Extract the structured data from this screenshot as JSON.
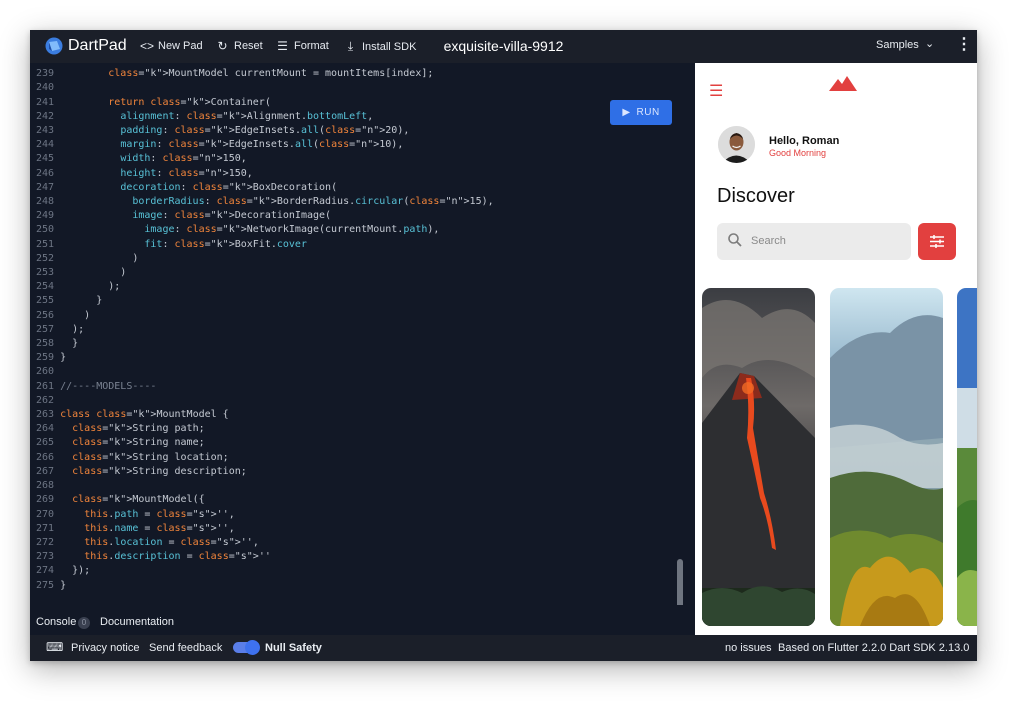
{
  "app": {
    "brand": "DartPad",
    "pad_title": "exquisite-villa-9912"
  },
  "toolbar": {
    "new_pad": "New Pad",
    "reset": "Reset",
    "format": "Format",
    "install_sdk": "Install SDK",
    "samples": "Samples"
  },
  "editor": {
    "run_label": "RUN",
    "lines": [
      {
        "n": "239",
        "code": "        MountModel currentMount = mountItems[index];"
      },
      {
        "n": "240",
        "code": ""
      },
      {
        "n": "241",
        "code": "        return Container("
      },
      {
        "n": "242",
        "code": "          alignment: Alignment.bottomLeft,"
      },
      {
        "n": "243",
        "code": "          padding: EdgeInsets.all(20),"
      },
      {
        "n": "244",
        "code": "          margin: EdgeInsets.all(10),"
      },
      {
        "n": "245",
        "code": "          width: 150,"
      },
      {
        "n": "246",
        "code": "          height: 150,"
      },
      {
        "n": "247",
        "code": "          decoration: BoxDecoration("
      },
      {
        "n": "248",
        "code": "            borderRadius: BorderRadius.circular(15),"
      },
      {
        "n": "249",
        "code": "            image: DecorationImage("
      },
      {
        "n": "250",
        "code": "              image: NetworkImage(currentMount.path),"
      },
      {
        "n": "251",
        "code": "              fit: BoxFit.cover"
      },
      {
        "n": "252",
        "code": "            )"
      },
      {
        "n": "253",
        "code": "          )"
      },
      {
        "n": "254",
        "code": "        );"
      },
      {
        "n": "255",
        "code": "      }"
      },
      {
        "n": "256",
        "code": "    )"
      },
      {
        "n": "257",
        "code": "  );"
      },
      {
        "n": "258",
        "code": "  }"
      },
      {
        "n": "259",
        "code": "}"
      },
      {
        "n": "260",
        "code": ""
      },
      {
        "n": "261",
        "code": "//----MODELS----"
      },
      {
        "n": "262",
        "code": ""
      },
      {
        "n": "263",
        "code": "class MountModel {"
      },
      {
        "n": "264",
        "code": "  String path;"
      },
      {
        "n": "265",
        "code": "  String name;"
      },
      {
        "n": "266",
        "code": "  String location;"
      },
      {
        "n": "267",
        "code": "  String description;"
      },
      {
        "n": "268",
        "code": ""
      },
      {
        "n": "269",
        "code": "  MountModel({"
      },
      {
        "n": "270",
        "code": "    this.path = '',"
      },
      {
        "n": "271",
        "code": "    this.name = '',"
      },
      {
        "n": "272",
        "code": "    this.location = '',"
      },
      {
        "n": "273",
        "code": "    this.description = ''"
      },
      {
        "n": "274",
        "code": "  });"
      },
      {
        "n": "275",
        "code": "}"
      }
    ]
  },
  "console": {
    "tab_label": "Console",
    "count": "0",
    "docs_label": "Documentation"
  },
  "status": {
    "privacy": "Privacy notice",
    "feedback": "Send feedback",
    "null_safety": "Null Safety",
    "null_safety_on": true,
    "issues": "no issues",
    "flutter_info": "Based on Flutter 2.2.0 Dart SDK 2.13.0"
  },
  "preview": {
    "greeting": "Hello, Roman",
    "subgreeting": "Good Morning",
    "heading": "Discover",
    "search_placeholder": "Search",
    "accent": "#e2403f"
  }
}
